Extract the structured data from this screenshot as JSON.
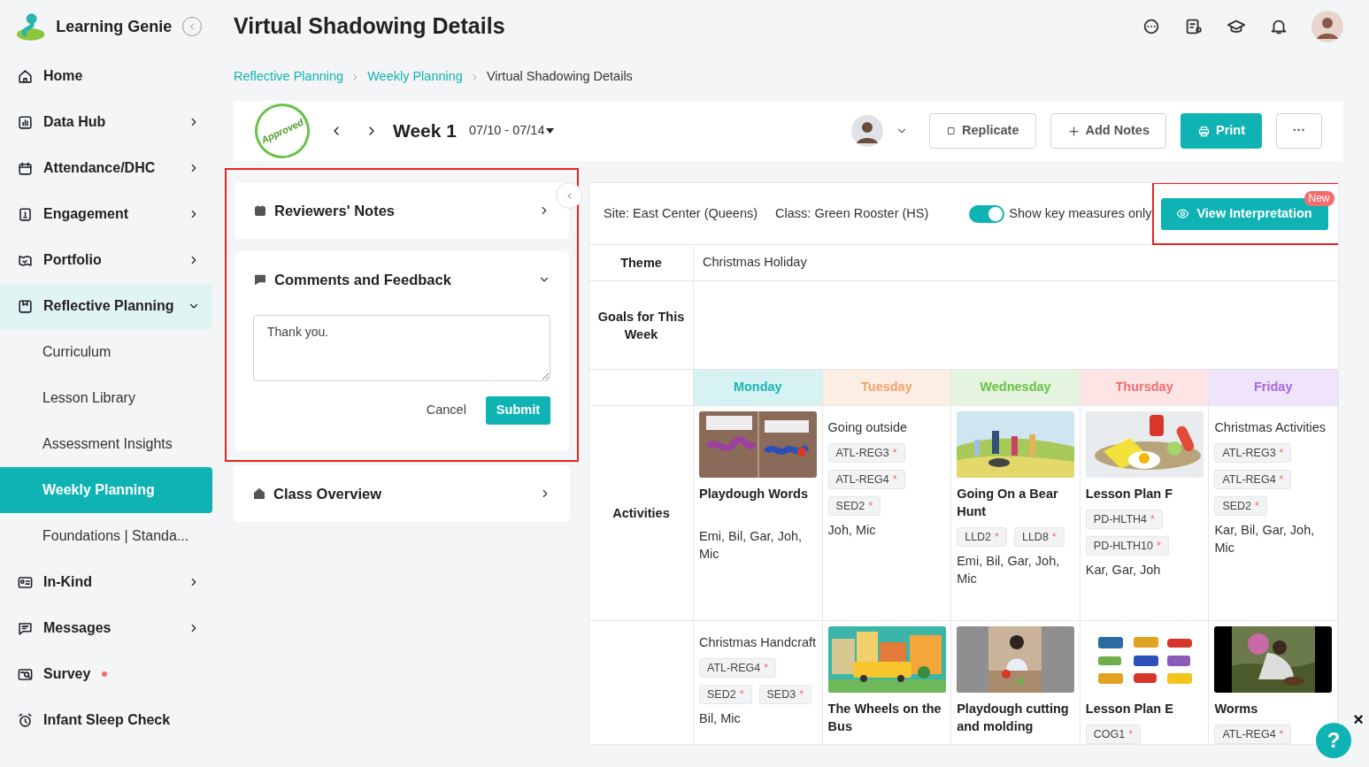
{
  "app": {
    "name": "Learning Genie"
  },
  "sidebar": {
    "items": [
      {
        "label": "Home",
        "kind": "link"
      },
      {
        "label": "Data Hub",
        "kind": "menu",
        "expanded": false
      },
      {
        "label": "Attendance/DHC",
        "kind": "menu",
        "expanded": false
      },
      {
        "label": "Engagement",
        "kind": "menu",
        "expanded": false
      },
      {
        "label": "Portfolio",
        "kind": "menu",
        "expanded": false
      },
      {
        "label": "Reflective Planning",
        "kind": "menu",
        "expanded": true,
        "children": [
          {
            "label": "Curriculum",
            "selected": false
          },
          {
            "label": "Lesson Library",
            "selected": false
          },
          {
            "label": "Assessment Insights",
            "selected": false
          },
          {
            "label": "Weekly Planning",
            "selected": true
          },
          {
            "label": "Foundations | Standa...",
            "selected": false
          }
        ]
      },
      {
        "label": "In-Kind",
        "kind": "menu",
        "expanded": false
      },
      {
        "label": "Messages",
        "kind": "menu",
        "expanded": false
      },
      {
        "label": "Survey",
        "kind": "link",
        "dot": true
      },
      {
        "label": "Infant Sleep Check",
        "kind": "link"
      }
    ]
  },
  "page_title": "Virtual Shadowing Details",
  "breadcrumb": [
    {
      "label": "Reflective Planning",
      "current": false
    },
    {
      "label": "Weekly Planning",
      "current": false
    },
    {
      "label": "Virtual Shadowing Details",
      "current": true
    }
  ],
  "week": {
    "stamp": "Approved",
    "label": "Week 1",
    "range": "07/10 - 07/14"
  },
  "actions": [
    {
      "label": "Replicate",
      "kind": "copy"
    },
    {
      "label": "Add Notes",
      "kind": "add"
    },
    {
      "label": "Print",
      "kind": "primary"
    },
    {
      "label": "···",
      "kind": "more"
    }
  ],
  "review_panel": {
    "sections": [
      {
        "title": "Reviewers' Notes",
        "expanded": false
      },
      {
        "title": "Comments and Feedback",
        "expanded": true,
        "comment": "Thank you.",
        "cancel": "Cancel",
        "submit": "Submit"
      },
      {
        "title": "Class Overview",
        "expanded": false
      }
    ]
  },
  "plan": {
    "site": "Site: East Center (Queens)",
    "class": "Class: Green Rooster (HS)",
    "toggle": {
      "label": "Show key measures only",
      "on": true
    },
    "view_button": {
      "label": "View Interpretation",
      "badge": "New"
    },
    "theme": {
      "label": "Theme",
      "value": "Christmas Holiday"
    },
    "goals": {
      "label": "Goals for This Week"
    },
    "days": [
      {
        "name": "Monday",
        "color": "#1cb5b5"
      },
      {
        "name": "Tuesday",
        "color": "#f3a26b"
      },
      {
        "name": "Wednesday",
        "color": "#6cc04a"
      },
      {
        "name": "Thursday",
        "color": "#f26d6d"
      },
      {
        "name": "Friday",
        "color": "#a968e0"
      }
    ],
    "rows": [
      {
        "label": "Activities",
        "cells": [
          {
            "kind": "lesson",
            "title": "Playdough Words",
            "names": "Emi, Bil, Gar, Joh, Mic"
          },
          {
            "kind": "note",
            "title": "Going outside",
            "tags": [
              {
                "code": "ATL-REG3",
                "mark": "*"
              },
              {
                "code": "ATL-REG4",
                "mark": "*"
              },
              {
                "code": "SED2",
                "mark": "*"
              }
            ],
            "names": "Joh, Mic"
          },
          {
            "kind": "lesson",
            "title": "Going On a Bear Hunt",
            "tags": [
              {
                "code": "LLD2",
                "mark": "*"
              },
              {
                "code": "LLD8",
                "mark": "*"
              }
            ],
            "names": "Emi, Bil, Gar, Joh, Mic"
          },
          {
            "kind": "lesson",
            "title": "Lesson Plan F",
            "tags": [
              {
                "code": "PD-HLTH4",
                "mark": "*"
              },
              {
                "code": "PD-HLTH10",
                "mark": "*"
              }
            ],
            "names": "Kar, Gar, Joh"
          },
          {
            "kind": "note",
            "title": "Christmas Activities",
            "tags": [
              {
                "code": "ATL-REG3",
                "mark": "*"
              },
              {
                "code": "ATL-REG4",
                "mark": "*"
              },
              {
                "code": "SED2",
                "mark": "*"
              }
            ],
            "names": "Kar, Bil, Gar, Joh, Mic"
          }
        ]
      },
      {
        "cells": [
          {
            "kind": "note",
            "title": "Christmas Handcraft",
            "tags": [
              {
                "code": "ATL-REG4",
                "mark": "*"
              },
              {
                "code": "SED2",
                "mark": "*"
              },
              {
                "code": "SED3",
                "mark": "*"
              }
            ],
            "names": "Bil, Mic"
          },
          {
            "kind": "lesson",
            "title": "The Wheels on the Bus"
          },
          {
            "kind": "lesson",
            "title": "Playdough cutting and molding"
          },
          {
            "kind": "lesson",
            "title": "Lesson Plan E",
            "tags": [
              {
                "code": "COG1",
                "mark": "*"
              }
            ]
          },
          {
            "kind": "lesson",
            "title": "Worms",
            "tags": [
              {
                "code": "ATL-REG4",
                "mark": "*"
              }
            ]
          }
        ]
      }
    ]
  },
  "help": {
    "label": "?",
    "close": "×"
  }
}
